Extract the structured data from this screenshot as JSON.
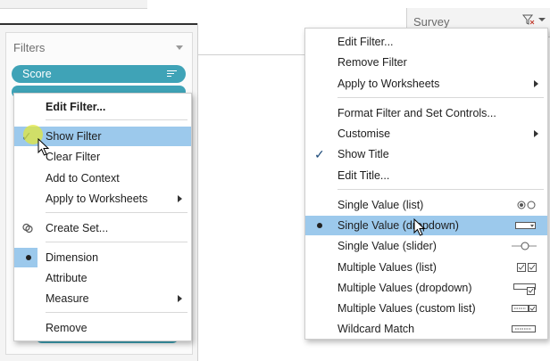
{
  "workspace": {
    "filters_title": "Filters",
    "pills": [
      {
        "label": "Score"
      }
    ],
    "survey_label": "Survey"
  },
  "colors": {
    "pill": "#3fa3b7",
    "menu_highlight": "#9cc9ec"
  },
  "context_menu": {
    "items": [
      {
        "label": "Edit Filter...",
        "bold": true
      },
      {
        "label": "Show Filter",
        "checked": true,
        "highlighted": true
      },
      {
        "label": "Clear Filter"
      },
      {
        "label": "Add to Context"
      },
      {
        "label": "Apply to Worksheets",
        "submenu": true
      },
      {
        "label": "Create Set...",
        "icon": "create-set-icon"
      },
      {
        "label": "Dimension",
        "selected": true
      },
      {
        "label": "Attribute"
      },
      {
        "label": "Measure",
        "submenu": true
      },
      {
        "label": "Remove"
      }
    ]
  },
  "card_menu": {
    "items": [
      {
        "label": "Edit Filter..."
      },
      {
        "label": "Remove Filter"
      },
      {
        "label": "Apply to Worksheets",
        "submenu": true
      },
      {
        "label": "Format Filter and Set Controls..."
      },
      {
        "label": "Customise",
        "submenu": true
      },
      {
        "label": "Show Title",
        "checked": true
      },
      {
        "label": "Edit Title..."
      },
      {
        "label": "Single Value (list)",
        "icon": "radio-list-icon"
      },
      {
        "label": "Single Value (dropdown)",
        "selected": true,
        "highlighted": true,
        "icon": "dropdown-icon"
      },
      {
        "label": "Single Value (slider)",
        "icon": "slider-icon"
      },
      {
        "label": "Multiple Values (list)",
        "icon": "checkbox-list-icon"
      },
      {
        "label": "Multiple Values (dropdown)",
        "icon": "multi-dropdown-icon"
      },
      {
        "label": "Multiple Values (custom list)",
        "icon": "custom-list-icon"
      },
      {
        "label": "Wildcard Match",
        "icon": "wildcard-icon"
      }
    ]
  }
}
